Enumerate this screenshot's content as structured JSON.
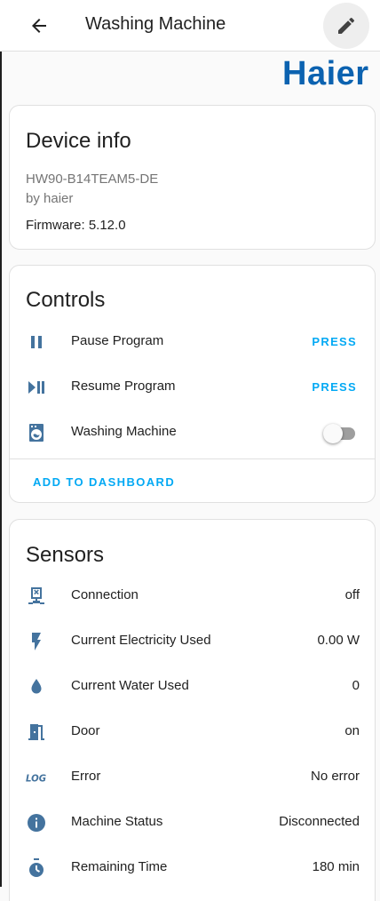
{
  "header": {
    "title": "Washing Machine"
  },
  "brand": {
    "logo_text": "Haier",
    "color": "#0b62b0"
  },
  "device_info": {
    "title": "Device info",
    "model": "HW90-B14TEAM5-DE",
    "manufacturer": "by haier",
    "firmware": "Firmware: 5.12.0"
  },
  "controls": {
    "title": "Controls",
    "items": [
      {
        "label": "Pause Program",
        "action": "PRESS",
        "icon": "pause-icon"
      },
      {
        "label": "Resume Program",
        "action": "PRESS",
        "icon": "play-pause-icon"
      },
      {
        "label": "Washing Machine",
        "toggle_on": false,
        "icon": "washing-machine-icon"
      }
    ],
    "add_to_dashboard": "ADD TO DASHBOARD"
  },
  "sensors": {
    "title": "Sensors",
    "items": [
      {
        "label": "Connection",
        "value": "off",
        "icon": "network-off-icon"
      },
      {
        "label": "Current Electricity Used",
        "value": "0.00 W",
        "icon": "flash-icon"
      },
      {
        "label": "Current Water Used",
        "value": "0",
        "icon": "water-drop-icon"
      },
      {
        "label": "Door",
        "value": "on",
        "icon": "door-open-icon"
      },
      {
        "label": "Error",
        "value": "No error",
        "icon": "log-icon"
      },
      {
        "label": "Machine Status",
        "value": "Disconnected",
        "icon": "info-icon"
      },
      {
        "label": "Remaining Time",
        "value": "180 min",
        "icon": "timer-icon"
      }
    ]
  },
  "colors": {
    "accent": "#03a9f4",
    "icon": "#44739e"
  }
}
